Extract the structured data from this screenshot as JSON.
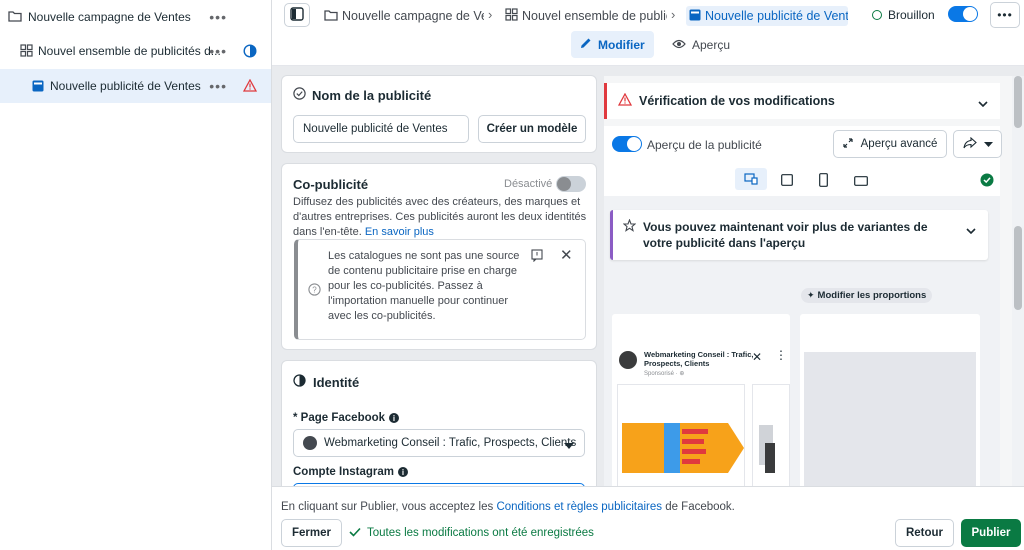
{
  "sidebar": {
    "items": [
      {
        "label": "Nouvelle campagne de Ventes",
        "dots": "•••"
      },
      {
        "label": "Nouvel ensemble de publicités d...",
        "dots": "•••"
      },
      {
        "label": "Nouvelle publicité de Ventes",
        "dots": "•••"
      }
    ]
  },
  "topbar": {
    "breadcrumbs": [
      {
        "label": "Nouvelle campagne de Ven"
      },
      {
        "label": "Nouvel ensemble de public"
      },
      {
        "label": "Nouvelle publicité de Vente"
      }
    ],
    "status": "Brouillon",
    "modes": {
      "edit": "Modifier",
      "preview": "Aperçu"
    }
  },
  "ad_name": {
    "title": "Nom de la publicité",
    "value": "Nouvelle publicité de Ventes",
    "template_button": "Créer un modèle"
  },
  "co_ad": {
    "title": "Co-publicité",
    "toggle_label": "Désactivé",
    "description": "Diffusez des publicités avec des créateurs, des marques et d'autres entreprises. Ces publicités auront les deux identités dans l'en-tête.",
    "learn_more": "En savoir plus",
    "notice": "Les catalogues ne sont pas une source de contenu publicitaire prise en charge pour les co-publicités. Passez à l'importation manuelle pour continuer avec les co-publicités."
  },
  "identity": {
    "title": "Identité",
    "page_label": "* Page Facebook",
    "page_value": "Webmarketing Conseil : Trafic, Prospects, Clients",
    "instagram_label": "Compte Instagram"
  },
  "preview": {
    "verification_title": "Vérification de vos modifications",
    "preview_toggle_label": "Aperçu de la publicité",
    "advanced_button": "Aperçu avancé",
    "variants_text": "Vous pouvez maintenant voir plus de variantes de votre publicité dans l'aperçu",
    "modify_proportions": "Modifier les proportions",
    "ad_page_name": "Webmarketing Conseil : Trafic, Prospects, Clients",
    "ad_sponsored": "Sponsorisé · ⊕"
  },
  "footer": {
    "terms_prefix": "En cliquant sur Publier, vous acceptez les ",
    "terms_link": "Conditions et règles publicitaires",
    "terms_suffix": " de Facebook.",
    "close_button": "Fermer",
    "saved_status": "Toutes les modifications ont été enregistrées",
    "back_button": "Retour",
    "publish_button": "Publier"
  },
  "colors": {
    "accent": "#0a78e6",
    "publish": "#0a7a43",
    "warning": "#e0393e",
    "selected_row": "#e7f0fb"
  }
}
